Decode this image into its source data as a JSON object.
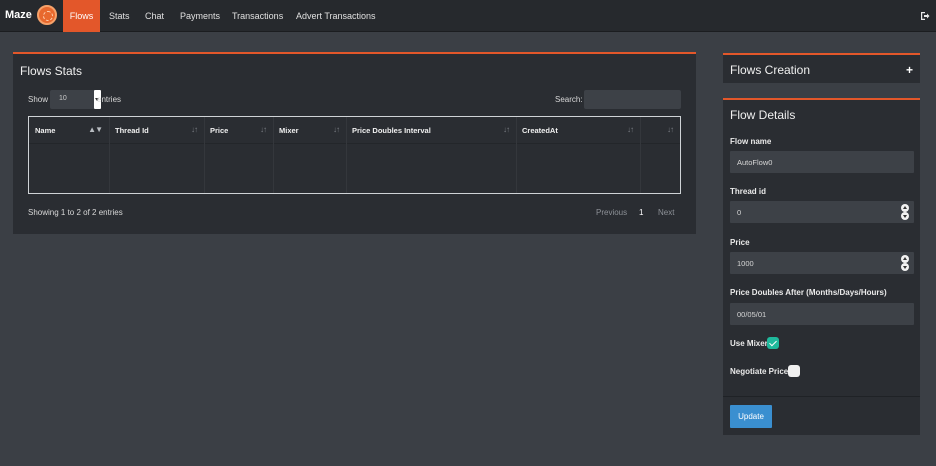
{
  "navbar": {
    "brand": "Maze",
    "items": [
      {
        "label": "Flows",
        "active": true
      },
      {
        "label": "Stats",
        "active": false
      },
      {
        "label": "Chat",
        "active": false
      },
      {
        "label": "Payments",
        "active": false
      },
      {
        "label": "Transactions",
        "active": false
      },
      {
        "label": "Advert Transactions",
        "active": false
      }
    ]
  },
  "stats": {
    "title": "Flows Stats",
    "show_label": "Show",
    "entries_value": "10",
    "entries_label": "entries",
    "search_label": "Search:",
    "search_value": "",
    "columns": [
      "Name",
      "Thread Id",
      "Price",
      "Mixer",
      "Price Doubles Interval",
      "CreatedAt",
      ""
    ],
    "rows": [],
    "showing_text": "Showing 1 to 2 of 2 entries",
    "pager": {
      "previous": "Previous",
      "page": "1",
      "next": "Next"
    }
  },
  "creation": {
    "title": "Flows Creation",
    "add_icon": "+"
  },
  "details": {
    "title": "Flow Details",
    "flow_name_label": "Flow name",
    "flow_name_value": "AutoFlow0",
    "thread_id_label": "Thread id",
    "thread_id_value": "0",
    "price_label": "Price",
    "price_value": "1000",
    "doubles_label": "Price Doubles After (Months/Days/Hours)",
    "doubles_value": "00/05/01",
    "use_mixer_label": "Use Mixer",
    "use_mixer_checked": true,
    "negotiate_label": "Negotiate Price",
    "negotiate_checked": false,
    "update_label": "Update"
  },
  "colors": {
    "accent": "#e3572a",
    "navbar_bg": "#26292d",
    "page_bg": "#3b3f45",
    "panel_bg": "#2a2d32",
    "checkbox_on": "#1fb99c",
    "button_primary": "#3a8fd0"
  }
}
